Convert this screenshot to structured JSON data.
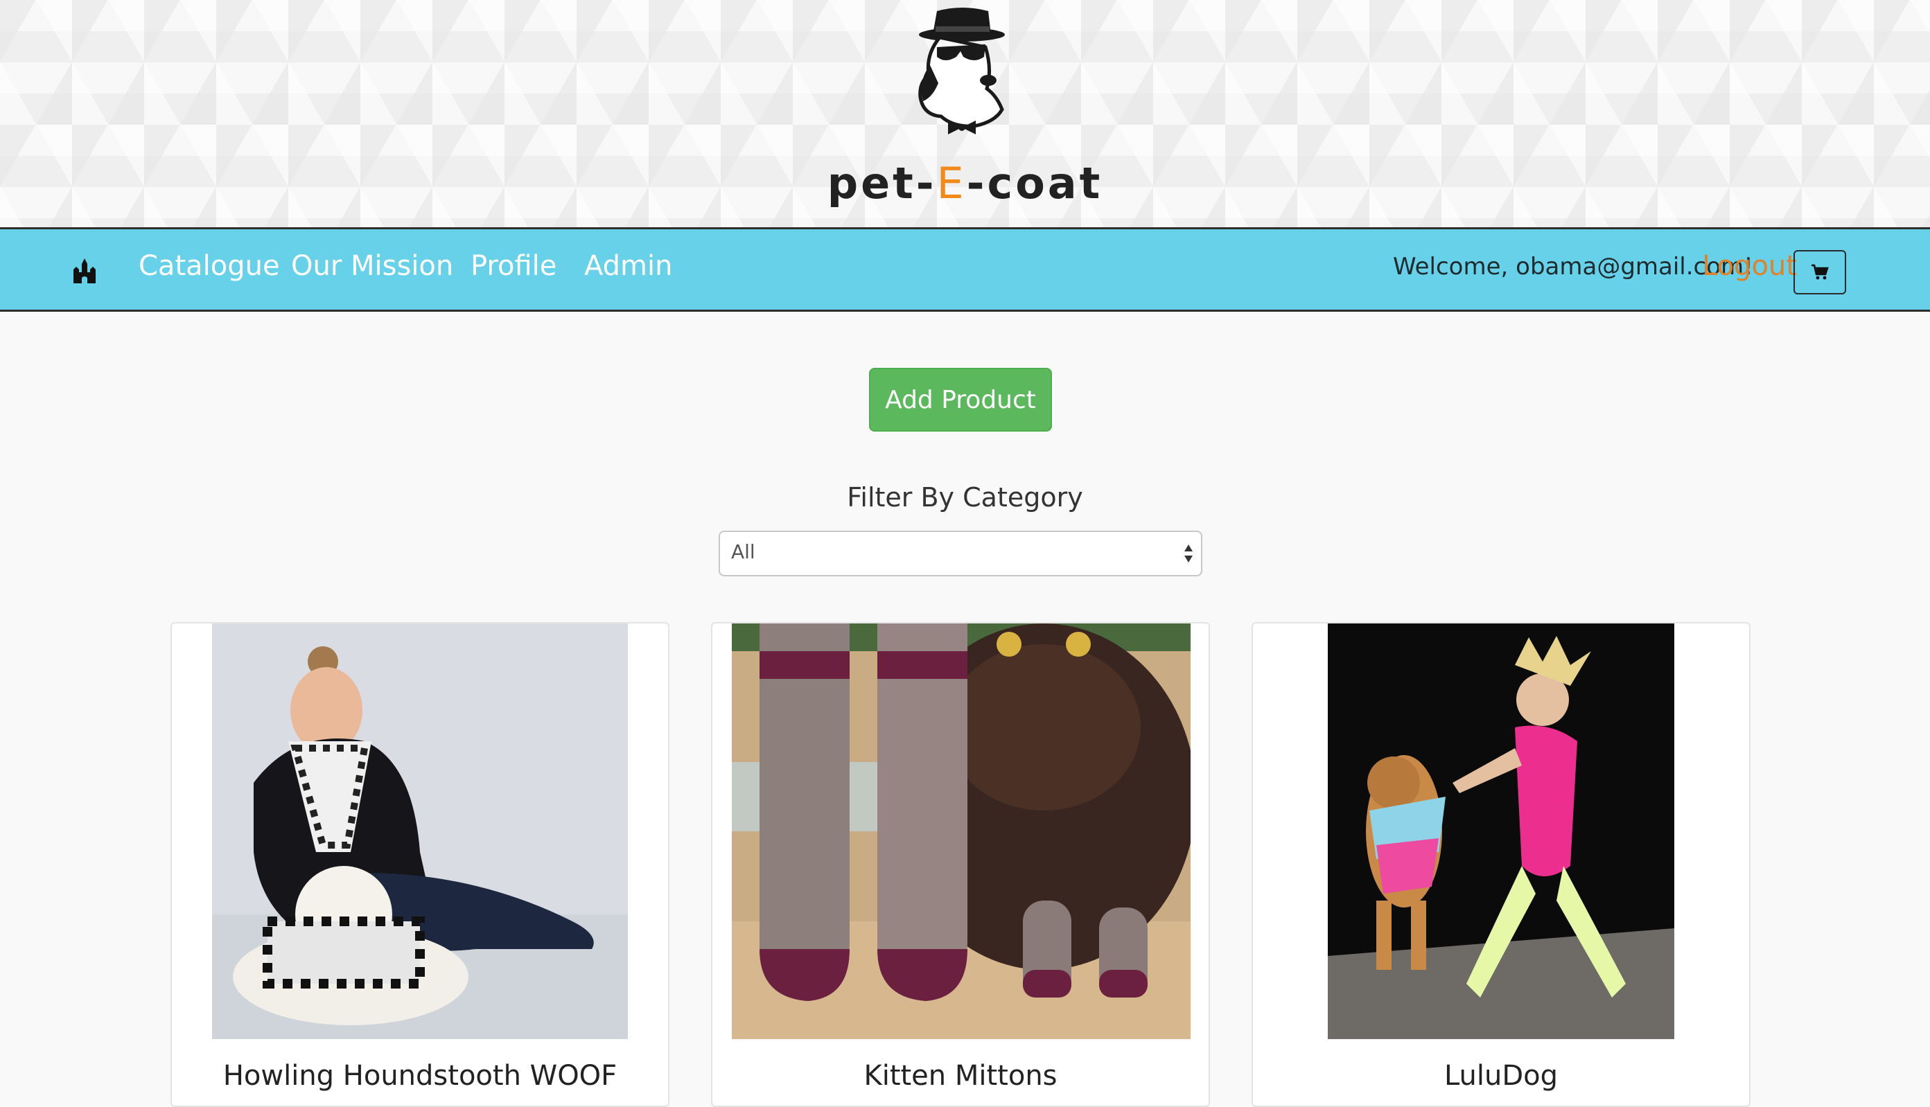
{
  "brand": {
    "prefix": "pet-",
    "highlight": "E",
    "suffix": "-coat"
  },
  "nav": {
    "links": [
      "Catalogue",
      "Our Mission",
      "Profile",
      "Admin"
    ],
    "welcome": "Welcome, obama@gmail.com!",
    "logout": "Logout"
  },
  "main": {
    "add_button": "Add Product",
    "filter_label": "Filter By Category",
    "filter_selected": "All"
  },
  "products": [
    {
      "title": "Howling Houndstooth WOOF"
    },
    {
      "title": "Kitten Mittons"
    },
    {
      "title": "LuluDog"
    }
  ],
  "colors": {
    "navbar": "#66d1e8",
    "accent": "#f08a1c",
    "add_button": "#5cb85c"
  }
}
